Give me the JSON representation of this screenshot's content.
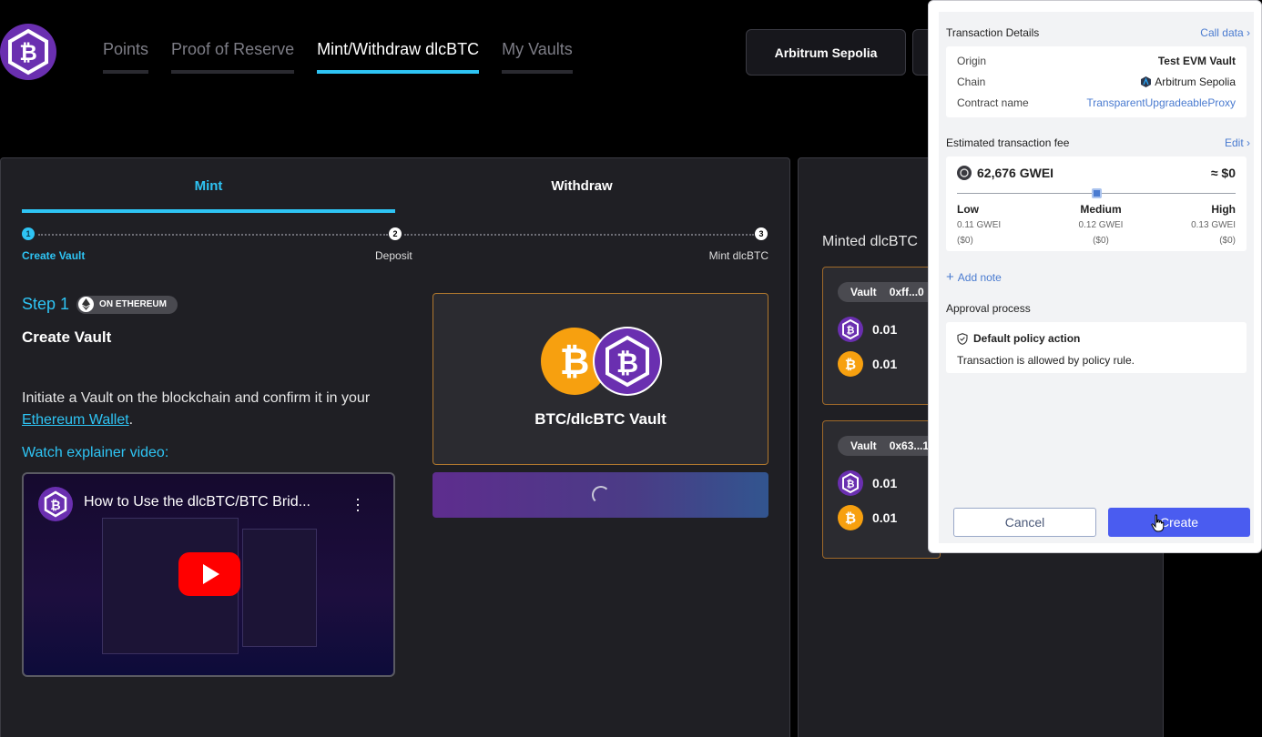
{
  "nav": {
    "items": [
      {
        "label": "Points",
        "active": false
      },
      {
        "label": "Proof of Reserve",
        "active": false
      },
      {
        "label": "Mint/Withdraw dlcBTC",
        "active": true
      },
      {
        "label": "My Vaults",
        "active": false
      }
    ],
    "chain_button": "Arbitrum Sepolia"
  },
  "mint_card": {
    "tabs": [
      "Mint",
      "Withdraw"
    ],
    "steps": [
      {
        "num": "1",
        "label": "Create Vault"
      },
      {
        "num": "2",
        "label": "Deposit"
      },
      {
        "num": "3",
        "label": "Mint dlcBTC"
      }
    ],
    "step_num": "Step 1",
    "badge": "ON ETHEREUM",
    "step_title": "Create Vault",
    "desc_pre": "Initiate a Vault on the blockchain and confirm it in your ",
    "desc_link": "Ethereum Wallet",
    "desc_post": ".",
    "watch": "Watch explainer video:",
    "video_title": "How to Use the dlcBTC/BTC Brid...",
    "vault_label": "BTC/dlcBTC Vault"
  },
  "minted": {
    "title": "Minted dlcBTC",
    "vaults": [
      {
        "label": "Vault",
        "id": "0xff...0",
        "dlc_amount": "0.01",
        "btc_amount": "0.01"
      },
      {
        "label": "Vault",
        "id": "0x63...1",
        "dlc_amount": "0.01",
        "btc_amount": "0.01"
      }
    ]
  },
  "tx": {
    "details_title": "Transaction Details",
    "call_data": "Call data",
    "rows": [
      {
        "k": "Origin",
        "v": "Test EVM Vault"
      },
      {
        "k": "Chain",
        "v": "Arbitrum Sepolia"
      },
      {
        "k": "Contract name",
        "v": "TransparentUpgradeableProxy"
      }
    ],
    "fee_title": "Estimated transaction fee",
    "fee_edit": "Edit",
    "fee_amount": "62,676 GWEI",
    "fee_usd": "≈ $0",
    "fee_level_frac": 0.5,
    "levels": [
      {
        "name": "Low",
        "gwei": "0.11 GWEI",
        "usd": "($0)"
      },
      {
        "name": "Medium",
        "gwei": "0.12 GWEI",
        "usd": "($0)"
      },
      {
        "name": "High",
        "gwei": "0.13 GWEI",
        "usd": "($0)"
      }
    ],
    "add_note": "Add note",
    "approval_title": "Approval process",
    "policy_title": "Default policy action",
    "policy_desc": "Transaction is allowed by policy rule.",
    "cancel": "Cancel",
    "create": "Create"
  },
  "colors": {
    "accent": "#2ec4f4",
    "brand_purple": "#6a2fb0",
    "btc_orange": "#f7a00f",
    "primary_button": "#4a5cf0"
  }
}
